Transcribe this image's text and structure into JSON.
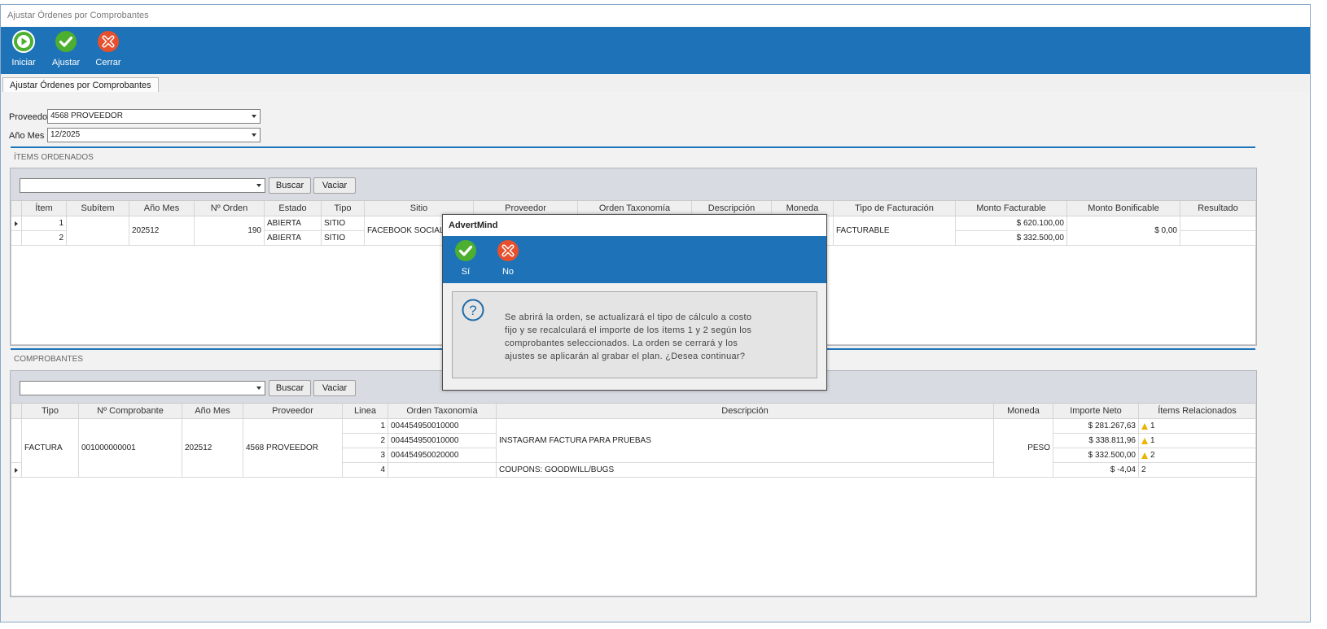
{
  "window": {
    "title": "Ajustar Órdenes por Comprobantes"
  },
  "toolbar": {
    "start_label": "Iniciar",
    "adjust_label": "Ajustar",
    "close_label": "Cerrar"
  },
  "tab": {
    "label": "Ajustar Órdenes por Comprobantes"
  },
  "filters": {
    "provider_label": "Proveedor",
    "provider_value": "4568 PROVEEDOR",
    "period_label": "Año Mes",
    "period_value": "12/2025"
  },
  "items_section": {
    "title": "ÍTEMS ORDENADOS",
    "search_value": "",
    "search_label": "Buscar",
    "clear_label": "Vaciar",
    "headers": [
      "Ítem",
      "Subítem",
      "Año Mes",
      "Nº Orden",
      "Estado",
      "Tipo",
      "Sitio",
      "Proveedor",
      "Orden Taxonomía",
      "Descripción",
      "Moneda",
      "Tipo de Facturación",
      "Monto Facturable",
      "Monto Bonificable",
      "Resultado"
    ],
    "merged": {
      "year_month": "202512",
      "order_no": "190",
      "site": "FACEBOOK SOCIAL",
      "billing_type": "FACTURABLE",
      "bonus_amount": "$ 0,00"
    },
    "rows": [
      {
        "item": "1",
        "status": "ABIERTA",
        "type": "SITIO",
        "amount": "$ 620.100,00"
      },
      {
        "item": "2",
        "status": "ABIERTA",
        "type": "SITIO",
        "amount": "$ 332.500,00"
      }
    ]
  },
  "vouchers_section": {
    "title": "COMPROBANTES",
    "search_value": "",
    "search_label": "Buscar",
    "clear_label": "Vaciar",
    "headers": [
      "Tipo",
      "Nº Comprobante",
      "Año Mes",
      "Proveedor",
      "Linea",
      "Orden Taxonomía",
      "Descripción",
      "Moneda",
      "Importe Neto",
      "Ítems Relacionados"
    ],
    "merged": {
      "type": "FACTURA",
      "number": "001000000001",
      "year_month": "202512",
      "provider": "4568 PROVEEDOR",
      "description_1_3": "INSTAGRAM FACTURA PARA PRUEBAS",
      "currency": "PESO"
    },
    "rows": [
      {
        "line": "1",
        "taxonomy": "004454950010000",
        "amount": "$ 281.267,63",
        "related": "1"
      },
      {
        "line": "2",
        "taxonomy": "004454950010000",
        "amount": "$ 338.811,96",
        "related": "1"
      },
      {
        "line": "3",
        "taxonomy": "004454950020000",
        "amount": "$ 332.500,00",
        "related": "2"
      },
      {
        "line": "4",
        "taxonomy": "",
        "description": "COUPONS: GOODWILL/BUGS",
        "amount": "$ -4,04",
        "related": "2"
      }
    ]
  },
  "dialog": {
    "title": "AdvertMind",
    "yes_label": "Sí",
    "no_label": "No",
    "message_lines": [
      "Se abrirá la orden, se actualizará el tipo de cálculo a costo",
      "fijo y se recalculará el importe de los ítems 1 y 2 según los",
      "comprobantes seleccionados. La orden se cerrará y los",
      "ajustes se aplicarán al grabar el plan. ¿Desea continuar?"
    ]
  },
  "colors": {
    "accent": "#1e73b8",
    "ok_green": "#4caf2f",
    "cancel_red": "#e8502d",
    "warning": "#e8b400"
  }
}
